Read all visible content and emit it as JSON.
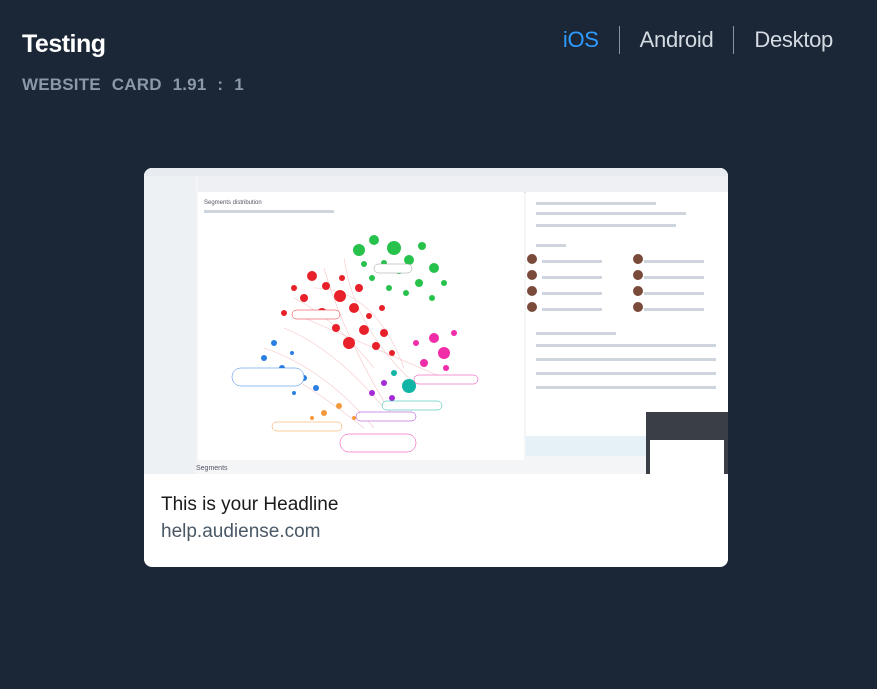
{
  "header": {
    "title": "Testing",
    "subtitle": "WEBSITE CARD   1.91 : 1"
  },
  "platform_tabs": [
    {
      "label": "iOS",
      "active": true
    },
    {
      "label": "Android",
      "active": false
    },
    {
      "label": "Desktop",
      "active": false
    }
  ],
  "card": {
    "headline": "This is your Headline",
    "domain": "help.audiense.com"
  },
  "preview_image": {
    "heading": "Segments distribution",
    "footer": "Segments",
    "bubble_colors": [
      "#e8202a",
      "#27c24c",
      "#f02ca8",
      "#2b7fe0",
      "#f59a3c",
      "#a52bd6",
      "#10b5a6"
    ]
  },
  "colors": {
    "background": "#1b2636",
    "active_tab": "#2e9bff",
    "tab": "#d4dae2",
    "subtitle": "#8a98aa"
  }
}
